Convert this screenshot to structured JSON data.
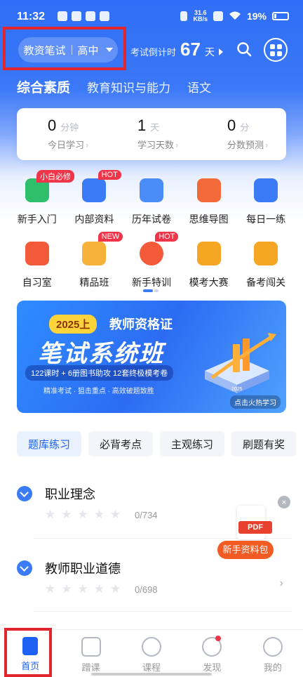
{
  "status_bar": {
    "time": "11:32",
    "net_speed_top": "31.6",
    "net_speed_unit": "KB/s",
    "battery": "19%"
  },
  "header": {
    "exam_type": "教资笔试",
    "level": "高中",
    "countdown_label": "考试倒计时",
    "countdown_days": "67",
    "countdown_unit": "天"
  },
  "category_tabs": [
    "综合素质",
    "教育知识与能力",
    "语文"
  ],
  "stats": [
    {
      "value": "0",
      "unit": "分钟",
      "label": "今日学习"
    },
    {
      "value": "1",
      "unit": "天",
      "label": "学习天数"
    },
    {
      "value": "0",
      "unit": "分",
      "label": "分数预测"
    }
  ],
  "features": [
    {
      "label": "新手入门",
      "icon": "beginner-icon",
      "color": "#2fbf6a",
      "badge": "小白必修"
    },
    {
      "label": "内部资料",
      "icon": "folder-icon",
      "color": "#3b7bf6",
      "badge": "HOT"
    },
    {
      "label": "历年试卷",
      "icon": "mail-paper-icon",
      "color": "#4b8df8",
      "badge": ""
    },
    {
      "label": "思维导图",
      "icon": "mindmap-icon",
      "color": "#f26a3a",
      "badge": ""
    },
    {
      "label": "每日一练",
      "icon": "daily-practice-icon",
      "color": "#3b7bf6",
      "badge": ""
    },
    {
      "label": "自习室",
      "icon": "study-room-icon",
      "color": "#f25a3a",
      "badge": ""
    },
    {
      "label": "精品班",
      "icon": "premium-class-icon",
      "color": "#f7b23a",
      "badge": "NEW"
    },
    {
      "label": "新手特训",
      "icon": "target-icon",
      "color": "#f25a3a",
      "badge": "HOT"
    },
    {
      "label": "模考大赛",
      "icon": "trophy-icon",
      "color": "#f5a623",
      "badge": ""
    },
    {
      "label": "备考闯关",
      "icon": "map-pin-icon",
      "color": "#f5a623",
      "badge": ""
    }
  ],
  "banner": {
    "year_tag": "2025上",
    "subtitle": "教师资格证",
    "title": "笔试系统班",
    "pill": "122课时 + 6册图书助攻  12套终极模考卷",
    "tags": "精准考试 · 狙击重点 · 高效破题致胜",
    "cta": "点击火热学习",
    "cover_label": "2025"
  },
  "sub_tabs": [
    "题库练习",
    "必背考点",
    "主观练习",
    "刷题有奖"
  ],
  "chapters": [
    {
      "name": "职业理念",
      "progress": "0/734"
    },
    {
      "name": "教师职业道德",
      "progress": "0/698"
    }
  ],
  "pdf_float": {
    "label": "PDF",
    "button": "新手资料包"
  },
  "bottom_nav": [
    {
      "label": "首页",
      "icon": "home-book-icon",
      "active": true
    },
    {
      "label": "蹭课",
      "icon": "video-icon",
      "active": false
    },
    {
      "label": "课程",
      "icon": "play-bubble-icon",
      "active": false
    },
    {
      "label": "发现",
      "icon": "compass-icon",
      "active": false,
      "dot": true
    },
    {
      "label": "我的",
      "icon": "smile-icon",
      "active": false
    }
  ]
}
